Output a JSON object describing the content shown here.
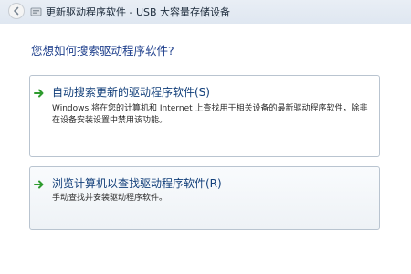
{
  "window": {
    "title": "更新驱动程序软件 - USB 大容量存储设备"
  },
  "main": {
    "question": "您想如何搜索驱动程序软件?",
    "options": [
      {
        "label": "自动搜索更新的驱动程序软件(S)",
        "description": "Windows 将在您的计算机和 Internet 上查找用于相关设备的最新驱动程序软件，除非在设备安装设置中禁用该功能。"
      },
      {
        "label": "浏览计算机以查找驱动程序软件(R)",
        "description": "手动查找并安装驱动程序软件。"
      }
    ]
  },
  "icons": {
    "back": "back-arrow-icon",
    "device": "usb-device-icon",
    "option_arrow": "green-arrow-icon"
  },
  "colors": {
    "question": "#1e3f8c",
    "option_title": "#123f7a",
    "arrow": "#2e9b2e"
  }
}
